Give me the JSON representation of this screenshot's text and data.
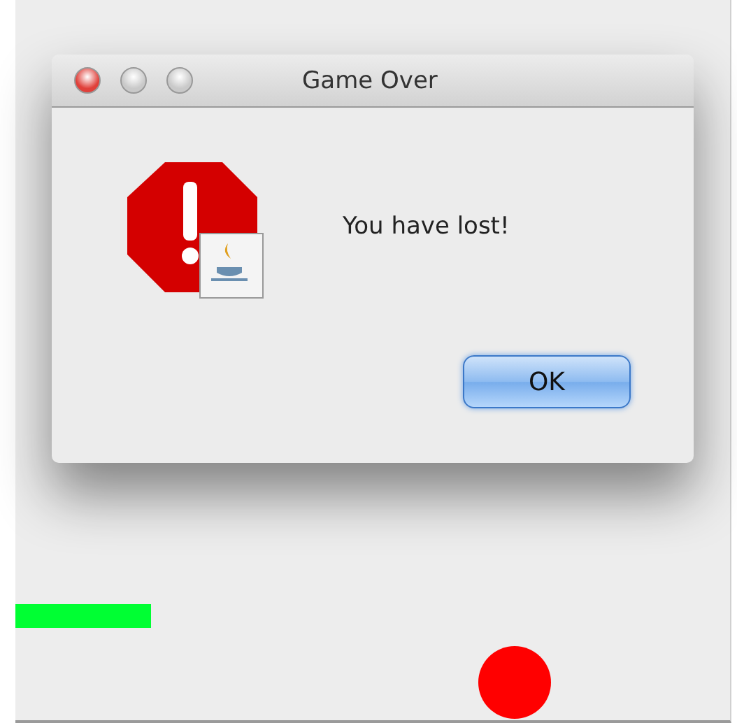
{
  "window": {
    "title": "Game Over"
  },
  "message": "You have lost!",
  "buttons": [
    {
      "label": "OK",
      "default": true
    }
  ]
}
